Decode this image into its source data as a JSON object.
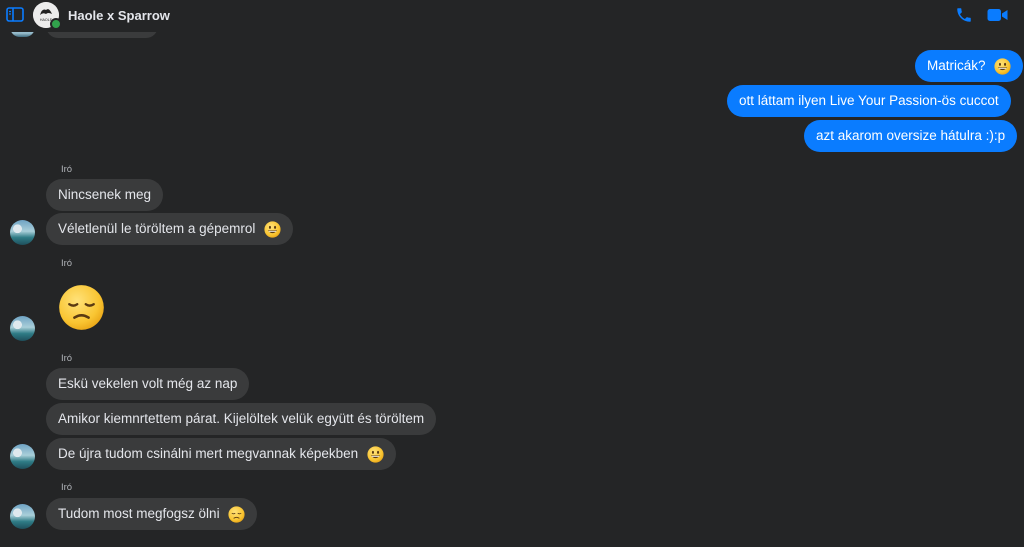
{
  "header": {
    "title": "Haole x Sparrow",
    "avatar_logo_text": "HAOLE"
  },
  "messages_out": [
    {
      "text": "Matricák? ",
      "emoji": "grinning-face"
    },
    {
      "text": "ott láttam ilyen Live Your Passion-ös cuccot"
    },
    {
      "text": "azt akarom oversize hátulra :):p"
    }
  ],
  "groups": [
    {
      "sender": "Iró",
      "messages": [
        {
          "text": "Nincsenek meg"
        },
        {
          "text": "Véletlenül le töröltem a gépemrol ",
          "emoji": "grinning-face"
        }
      ]
    },
    {
      "sender": "Iró",
      "messages": [
        {
          "emoji": "disappointed-face"
        }
      ]
    },
    {
      "sender": "Iró",
      "messages": [
        {
          "text": "Eskü vekelen volt még az nap"
        },
        {
          "text": "Amikor kiemnrtettem párat. Kijelöltek velük együtt és töröltem"
        },
        {
          "text": "De újra tudom csinálni mert megvannak képekben ",
          "emoji": "grinning-face"
        }
      ]
    },
    {
      "sender": "Iró",
      "messages": [
        {
          "text": "Tudom most megfogsz ölni ",
          "emoji": "disappointed-face"
        }
      ]
    }
  ],
  "colors": {
    "background": "#242526",
    "incoming_bubble": "#3a3b3c",
    "outgoing_bubble": "#0a7cff",
    "accent_icons": "#0a7cff",
    "online": "#31a24c"
  }
}
